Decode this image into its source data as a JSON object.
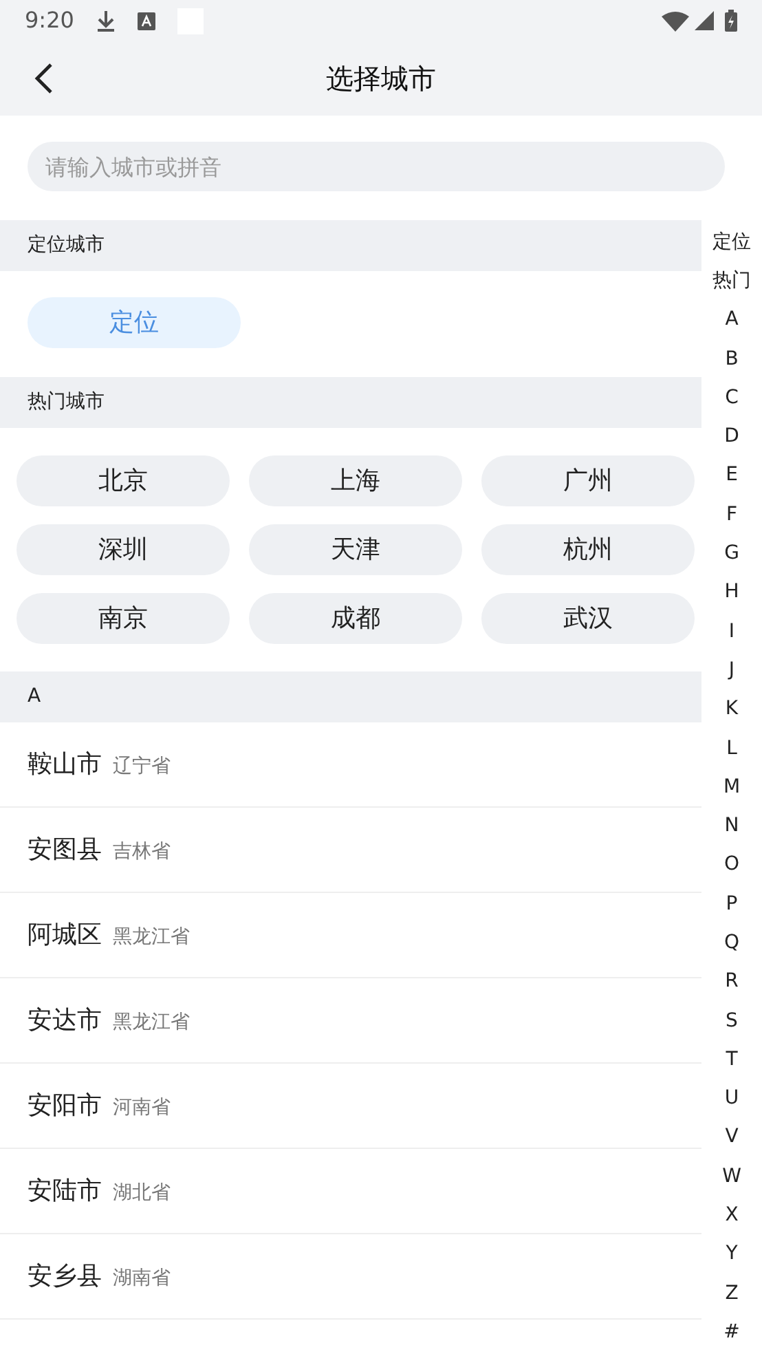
{
  "status_bar": {
    "time": "9:20"
  },
  "header": {
    "title": "选择城市"
  },
  "search": {
    "placeholder": "请输入城市或拼音"
  },
  "located_section": {
    "title": "定位城市",
    "button": "定位"
  },
  "hot_section": {
    "title": "热门城市",
    "cities": [
      "北京",
      "上海",
      "广州",
      "深圳",
      "天津",
      "杭州",
      "南京",
      "成都",
      "武汉"
    ]
  },
  "city_sections": [
    {
      "letter": "A",
      "cities": [
        {
          "name": "鞍山市",
          "province": "辽宁省"
        },
        {
          "name": "安图县",
          "province": "吉林省"
        },
        {
          "name": "阿城区",
          "province": "黑龙江省"
        },
        {
          "name": "安达市",
          "province": "黑龙江省"
        },
        {
          "name": "安阳市",
          "province": "河南省"
        },
        {
          "name": "安陆市",
          "province": "湖北省"
        },
        {
          "name": "安乡县",
          "province": "湖南省"
        }
      ]
    }
  ],
  "index_bar": [
    "定位",
    "热门",
    "A",
    "B",
    "C",
    "D",
    "E",
    "F",
    "G",
    "H",
    "I",
    "J",
    "K",
    "L",
    "M",
    "N",
    "O",
    "P",
    "Q",
    "R",
    "S",
    "T",
    "U",
    "V",
    "W",
    "X",
    "Y",
    "Z",
    "#"
  ]
}
